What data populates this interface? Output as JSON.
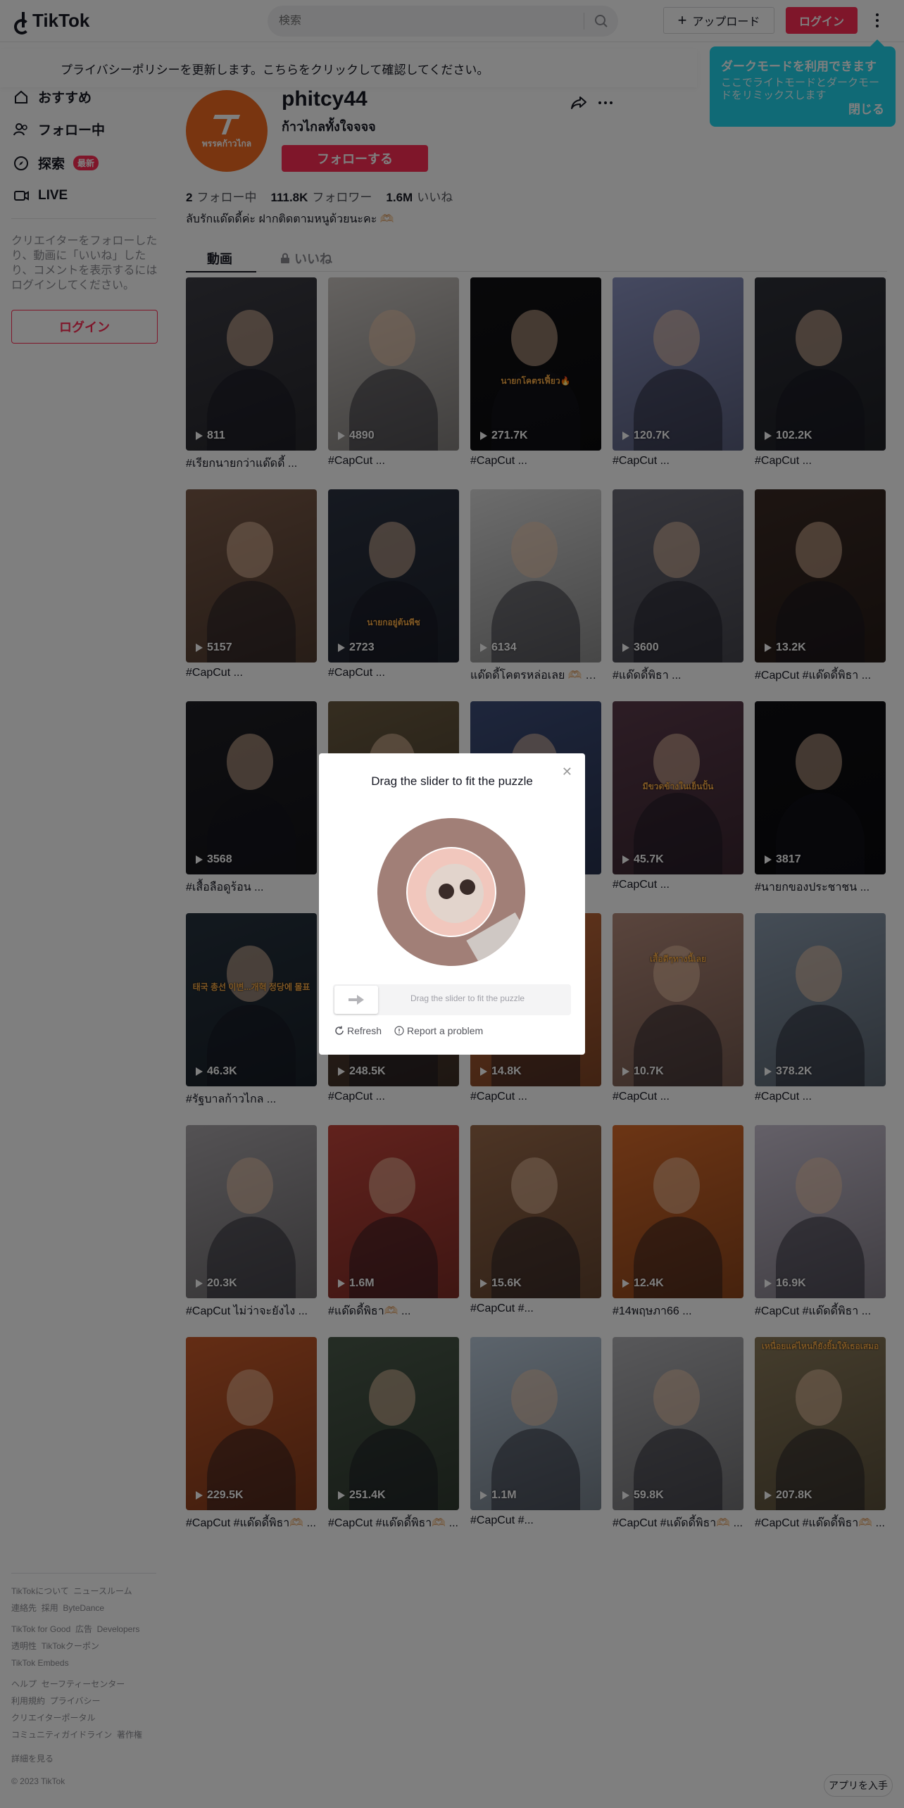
{
  "header": {
    "logo_text": "TikTok",
    "search_placeholder": "検索",
    "upload_label": "アップロード",
    "login_label": "ログイン"
  },
  "privacy_banner": "プライバシーポリシーを更新します。こちらをクリックして確認してください。",
  "darkmode_tip": {
    "title": "ダークモードを利用できます",
    "text": "ここでライトモードとダークモードをリミックスします",
    "close": "閉じる"
  },
  "sidebar": {
    "items": [
      {
        "label": "おすすめ",
        "icon": "home-icon"
      },
      {
        "label": "フォロー中",
        "icon": "following-icon"
      },
      {
        "label": "探索",
        "icon": "explore-icon",
        "badge": "最新"
      },
      {
        "label": "LIVE",
        "icon": "live-icon"
      }
    ],
    "note": "クリエイターをフォローしたり、動画に「いいね」したり、コメントを表示するにはログインしてください。",
    "login_label": "ログイン",
    "footer": {
      "group1": [
        "TikTokについて",
        "ニュースルーム",
        "連絡先",
        "採用",
        "ByteDance"
      ],
      "group2": [
        "TikTok for Good",
        "広告",
        "Developers",
        "透明性",
        "TikTokクーポン",
        "TikTok Embeds"
      ],
      "group3": [
        "ヘルプ",
        "セーフティーセンター",
        "利用規約",
        "プライバシー",
        "クリエイターポータル",
        "コミュニティガイドライン",
        "著作権"
      ],
      "more": "詳細を見る",
      "copyright": "© 2023 TikTok"
    }
  },
  "profile": {
    "username": "phitcy44",
    "nickname": "ก้าวไกลทั้งใจจจจ",
    "avatar_text": "พรรคก้าวไกล",
    "follow_label": "フォローする",
    "stats": [
      {
        "value": "2",
        "label": "フォロー中"
      },
      {
        "value": "111.8K",
        "label": "フォロワー"
      },
      {
        "value": "1.6M",
        "label": "いいね"
      }
    ],
    "bio": "ลับรักแด๊ดดี้ค่ะ ฝากติดตามหนูด้วยนะคะ 🫶🏻",
    "tabs": [
      {
        "label": "動画",
        "active": true
      },
      {
        "label": "いいね",
        "active": false,
        "icon": "lock-icon"
      }
    ]
  },
  "videos": [
    {
      "views": "811",
      "caption": "#เรียกนายกว่าแด๊ดดี้ ...",
      "color": "#3c3c44"
    },
    {
      "views": "4890",
      "caption": "#CapCut ...",
      "color": "#c9c4c0"
    },
    {
      "views": "271.7K",
      "caption": "#CapCut ...",
      "color": "#111114"
    },
    {
      "views": "120.7K",
      "caption": "#CapCut ...",
      "color": "#8a92c0"
    },
    {
      "views": "102.2K",
      "caption": "#CapCut ...",
      "color": "#2e3038"
    },
    {
      "views": "5157",
      "caption": "#CapCut ...",
      "color": "#7a5a48"
    },
    {
      "views": "2723",
      "caption": "#CapCut ...",
      "color": "#2c3342"
    },
    {
      "views": "6134",
      "caption": "แด๊ดดี้โคตรหล่อเลย 🫶🏻 🫶🏻...",
      "color": "#d9d9d9"
    },
    {
      "views": "3600",
      "caption": "#แด๊ดดี้พิธา ...",
      "color": "#6a6a76"
    },
    {
      "views": "13.2K",
      "caption": "#CapCut #แด๊ดดี้พิธา ...",
      "color": "#3a2a24"
    },
    {
      "views": "3568",
      "caption": "#เสื้อลือดูร้อน ...",
      "color": "#1e1e24"
    },
    {
      "views": "",
      "caption": "",
      "color": "#6a5a40"
    },
    {
      "views": "",
      "caption": "",
      "color": "#3c4c78"
    },
    {
      "views": "45.7K",
      "caption": "#CapCut ...",
      "color": "#5a3a4a"
    },
    {
      "views": "3817",
      "caption": "#นายกของประชาชน ...",
      "color": "#0e0e12"
    },
    {
      "views": "46.3K",
      "caption": "#รัฐบาลก้าวไกล ...",
      "color": "#26323e"
    },
    {
      "views": "248.5K",
      "caption": "#CapCut ...",
      "color": "#5c4638"
    },
    {
      "views": "14.8K",
      "caption": "#CapCut ...",
      "color": "#c46a3a"
    },
    {
      "views": "10.7K",
      "caption": "#CapCut ...",
      "color": "#b48a7a"
    },
    {
      "views": "378.2K",
      "caption": "#CapCut ...",
      "color": "#8a9aac"
    },
    {
      "views": "20.3K",
      "caption": "#CapCut ไม่ว่าจะยังไง ...",
      "color": "#a8a4a8"
    },
    {
      "views": "1.6M",
      "caption": "#แด๊ดดี้พิธา🫶🏻 ...",
      "color": "#c2443a"
    },
    {
      "views": "15.6K",
      "caption": "#CapCut #...",
      "color": "#9a6a4a"
    },
    {
      "views": "12.4K",
      "caption": "#14พฤษภา66 ...",
      "color": "#d86a2a"
    },
    {
      "views": "16.9K",
      "caption": "#CapCut #แด๊ดดี้พิธา ...",
      "color": "#c8c0d0"
    },
    {
      "views": "229.5K",
      "caption": "#CapCut #แด๊ดดี้พิธา🫶🏻 ...",
      "color": "#c85a2a"
    },
    {
      "views": "251.4K",
      "caption": "#CapCut #แด๊ดดี้พิธา🫶🏻 ...",
      "color": "#4a5a4a"
    },
    {
      "views": "1.1M",
      "caption": "#CapCut #...",
      "color": "#b8c8d8"
    },
    {
      "views": "59.8K",
      "caption": "#CapCut #แด๊ดดี้พิธา🫶🏻 ...",
      "color": "#b0b0b4"
    },
    {
      "views": "207.8K",
      "caption": "#CapCut #แด๊ดดี้พิธา🫶🏻 ...",
      "color": "#8a7a5a"
    }
  ],
  "thumb_texts": {
    "v3_top": "นายกโคตรเฟี้ยว🔥",
    "v7": "นายกอยู่ต้นพีช",
    "v14_top": "มีขวดข้างในเย็นปั้น",
    "v15_banner": "태국 총선 이변...개혁 정당에 몰표",
    "v19_top": "เสื้อดีๆทางนี้เลย",
    "v30_top": "เหนื่อยแค่ไหนก็ยังยิ้มให้เธอเสมอ"
  },
  "captcha": {
    "title": "Drag the slider to fit the puzzle",
    "slider_hint": "Drag the slider to fit the puzzle",
    "refresh": "Refresh",
    "report": "Report a problem"
  },
  "get_app": "アプリを入手"
}
